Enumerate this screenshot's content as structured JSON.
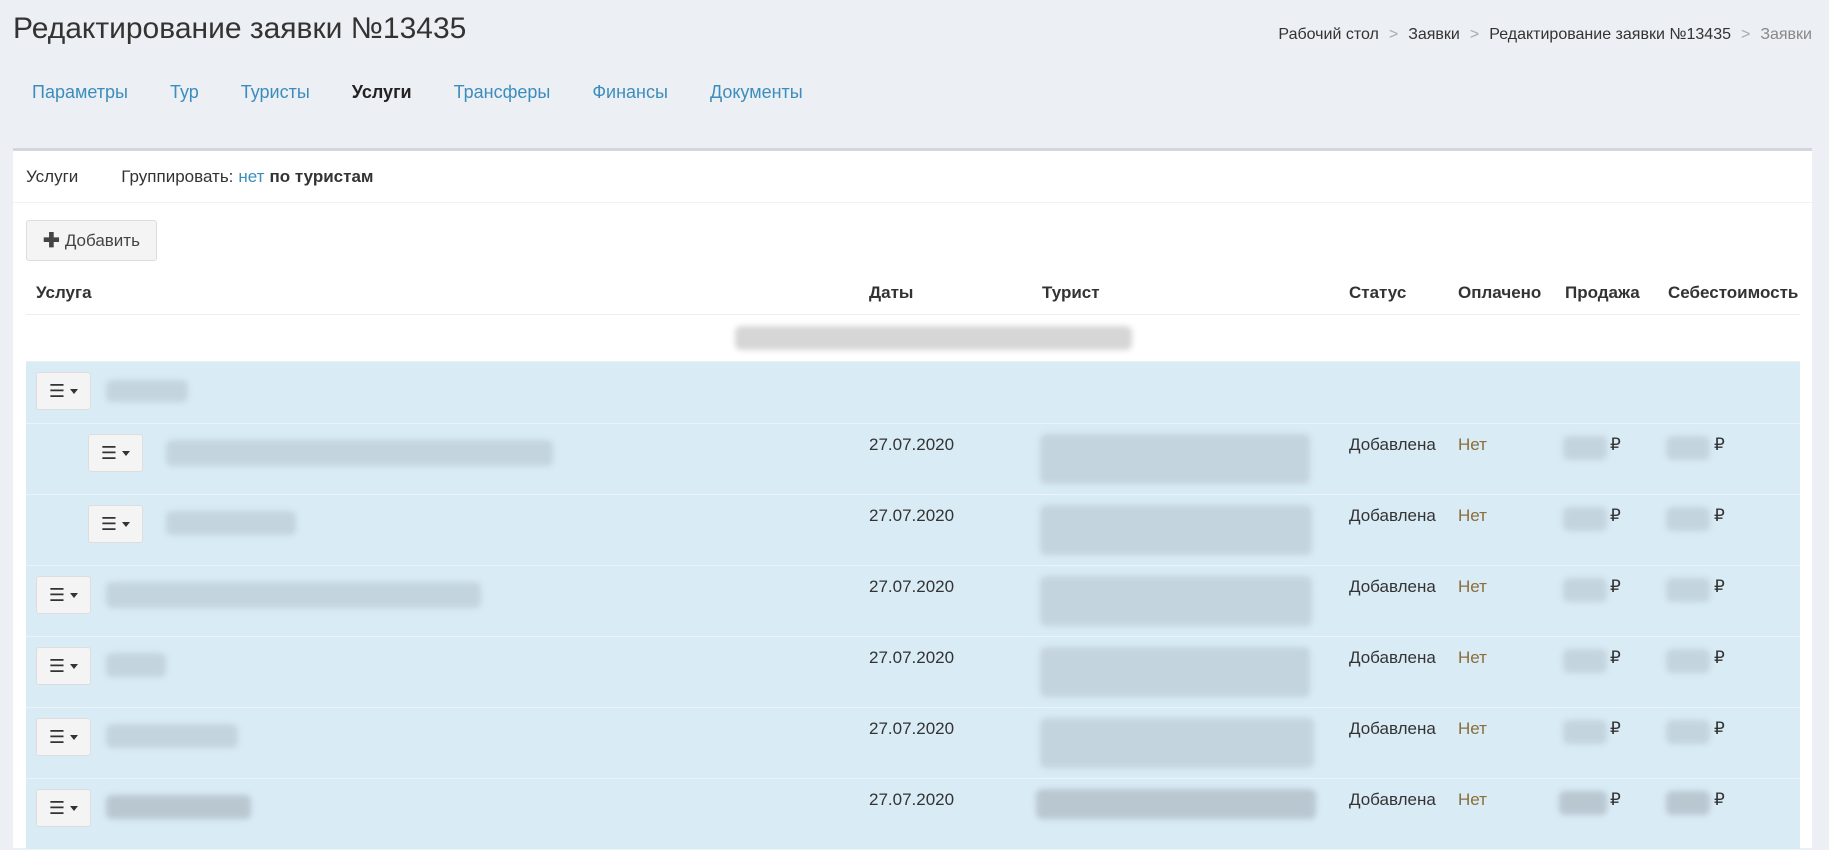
{
  "page": {
    "title": "Редактирование заявки №13435"
  },
  "breadcrumb": {
    "items": [
      "Рабочий стол",
      "Заявки",
      "Редактирование заявки №13435"
    ],
    "active": "Заявки",
    "separator": ">"
  },
  "tabs": [
    {
      "label": "Параметры",
      "active": false
    },
    {
      "label": "Тур",
      "active": false
    },
    {
      "label": "Туристы",
      "active": false
    },
    {
      "label": "Услуги",
      "active": true
    },
    {
      "label": "Трансферы",
      "active": false
    },
    {
      "label": "Финансы",
      "active": false
    },
    {
      "label": "Документы",
      "active": false
    }
  ],
  "panel": {
    "title": "Услуги",
    "group_label": "Группировать:",
    "group_none": "нет",
    "group_by_tourist": "по туристам",
    "add_label": "Добавить"
  },
  "table": {
    "columns": [
      "Услуга",
      "Даты",
      "Турист",
      "Статус",
      "Оплачено",
      "Продажа",
      "Себестоимость"
    ],
    "rows": [
      {
        "date": "",
        "status": "",
        "paid": "",
        "currency": ""
      },
      {
        "date": "27.07.2020",
        "status": "Добавлена",
        "paid": "Нет",
        "currency": "₽"
      },
      {
        "date": "27.07.2020",
        "status": "Добавлена",
        "paid": "Нет",
        "currency": "₽"
      },
      {
        "date": "27.07.2020",
        "status": "Добавлена",
        "paid": "Нет",
        "currency": "₽"
      },
      {
        "date": "27.07.2020",
        "status": "Добавлена",
        "paid": "Нет",
        "currency": "₽"
      },
      {
        "date": "27.07.2020",
        "status": "Добавлена",
        "paid": "Нет",
        "currency": "₽"
      },
      {
        "date": "27.07.2020",
        "status": "Добавлена",
        "paid": "Нет",
        "currency": "₽"
      }
    ]
  },
  "icons": {
    "add": "plus-icon",
    "row_menu": "hamburger-icon"
  },
  "colors": {
    "link": "#3c8dbc",
    "row_bg": "#d9ebf5",
    "paid_no": "#8a6d3b",
    "page_bg": "#eceff4"
  }
}
